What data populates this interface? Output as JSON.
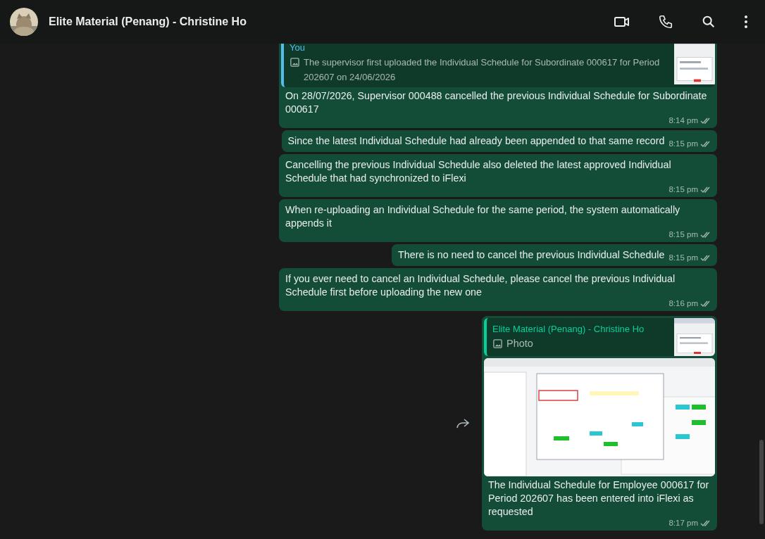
{
  "header": {
    "title": "Elite Material (Penang) - Christine Ho"
  },
  "messages": [
    {
      "kind": "reply",
      "quote": {
        "author": "You",
        "text": "The supervisor first uploaded the Individual Schedule for Subordinate 000617 for Period 202607 on 24/06/2026"
      },
      "text": "On 28/07/2026, Supervisor 000488 cancelled the previous Individual Schedule for Subordinate 000617",
      "time": "8:14 pm",
      "read": false
    },
    {
      "kind": "text",
      "text": "Since the latest Individual Schedule had already been appended to that same record",
      "time": "8:15 pm",
      "read": false
    },
    {
      "kind": "text",
      "text": "Cancelling the previous Individual Schedule also deleted the latest approved Individual Schedule that had synchronized to iFlexi",
      "time": "8:15 pm",
      "read": false
    },
    {
      "kind": "text",
      "text": "When re-uploading an Individual Schedule for the same period, the system automatically appends it",
      "time": "8:15 pm",
      "read": false
    },
    {
      "kind": "text",
      "text": "There is no need to cancel the previous Individual Schedule",
      "time": "8:15 pm",
      "read": false
    },
    {
      "kind": "text",
      "text": "If you ever need to cancel an Individual Schedule, please cancel the previous Individual Schedule first before uploading the new one",
      "time": "8:16 pm",
      "read": false
    },
    {
      "forwardable": true,
      "quote": {
        "author": "Elite Material (Penang) - Christine Ho",
        "text": "Photo"
      },
      "text": "The Individual Schedule for Employee 000617 for Period 202607 has been entered into iFlexi as requested",
      "time": "8:17 pm",
      "read": false
    }
  ]
}
